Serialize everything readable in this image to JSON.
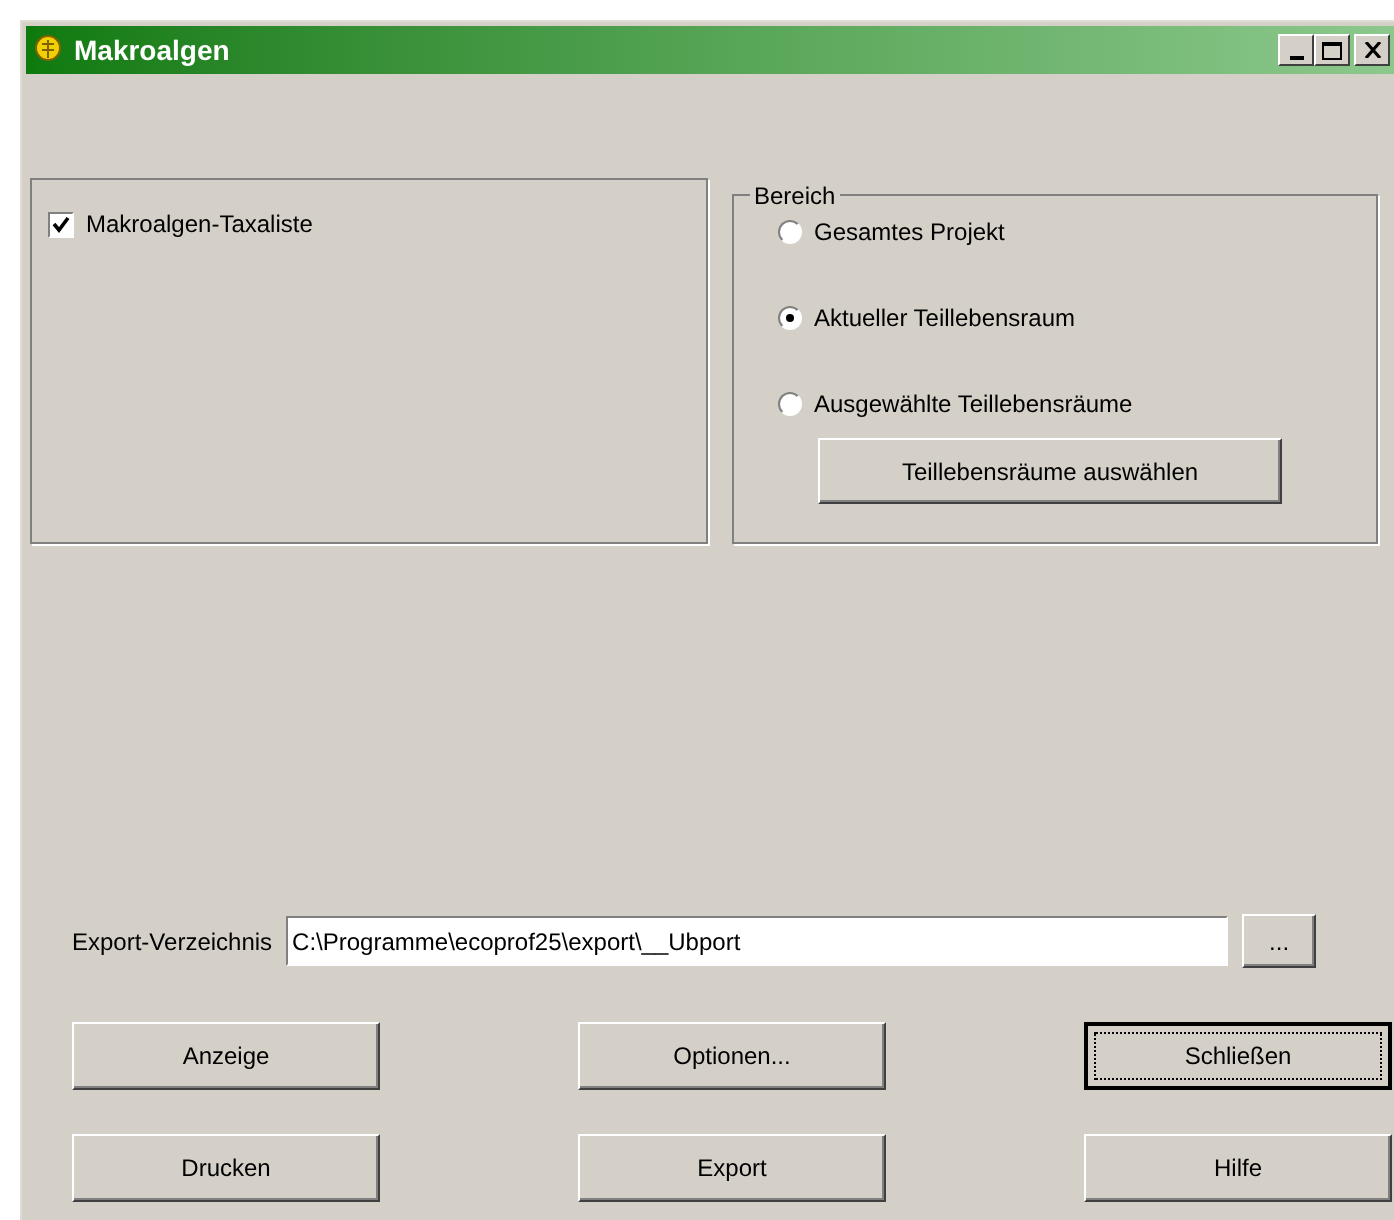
{
  "window": {
    "title": "Makroalgen"
  },
  "lists": [
    {
      "label": "Makroalgen-Taxaliste",
      "checked": true
    }
  ],
  "bereich": {
    "title": "Bereich",
    "options": [
      {
        "label": "Gesamtes Projekt",
        "selected": false
      },
      {
        "label": "Aktueller Teillebensraum",
        "selected": true
      },
      {
        "label": "Ausgewählte Teillebensräume",
        "selected": false
      }
    ],
    "button": "Teillebensräume auswählen"
  },
  "export": {
    "label": "Export-Verzeichnis",
    "value": "C:\\Programme\\ecoprof25\\export\\__Ubport",
    "browse": "..."
  },
  "buttons": [
    {
      "label": "Anzeige",
      "focused": false
    },
    {
      "label": "Optionen...",
      "focused": false
    },
    {
      "label": "Schließen",
      "focused": true
    },
    {
      "label": "Drucken",
      "focused": false
    },
    {
      "label": "Export",
      "focused": false
    },
    {
      "label": "Hilfe",
      "focused": false
    }
  ]
}
